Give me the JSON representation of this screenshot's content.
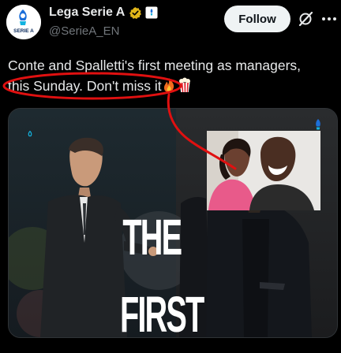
{
  "post": {
    "author": {
      "display_name": "Lega Serie A",
      "handle": "@SerieA_EN",
      "avatar_icon": "serie-a-logo",
      "avatar_label": "SERIE A",
      "verified_color": "#e2b719",
      "affiliate_color": "#1d9bf0"
    },
    "follow_label": "Follow",
    "grok_icon": "grok-icon",
    "text_line_1": "Conte and Spalletti's first meeting as managers,",
    "text_line_2": "this Sunday. Don't miss it",
    "emojis": [
      "fire-emoji",
      "popcorn-emoji"
    ]
  },
  "media": {
    "headline": "THE FIRST",
    "headline_line_1": "THE",
    "headline_line_2": "FIRST",
    "annotation_color": "#e01010",
    "inset_photo": "two-people-selfie"
  },
  "theme": {
    "background": "#000000",
    "text": "#e7e9ea",
    "secondary_text": "#71767b",
    "follow_bg": "#eff3f4"
  }
}
